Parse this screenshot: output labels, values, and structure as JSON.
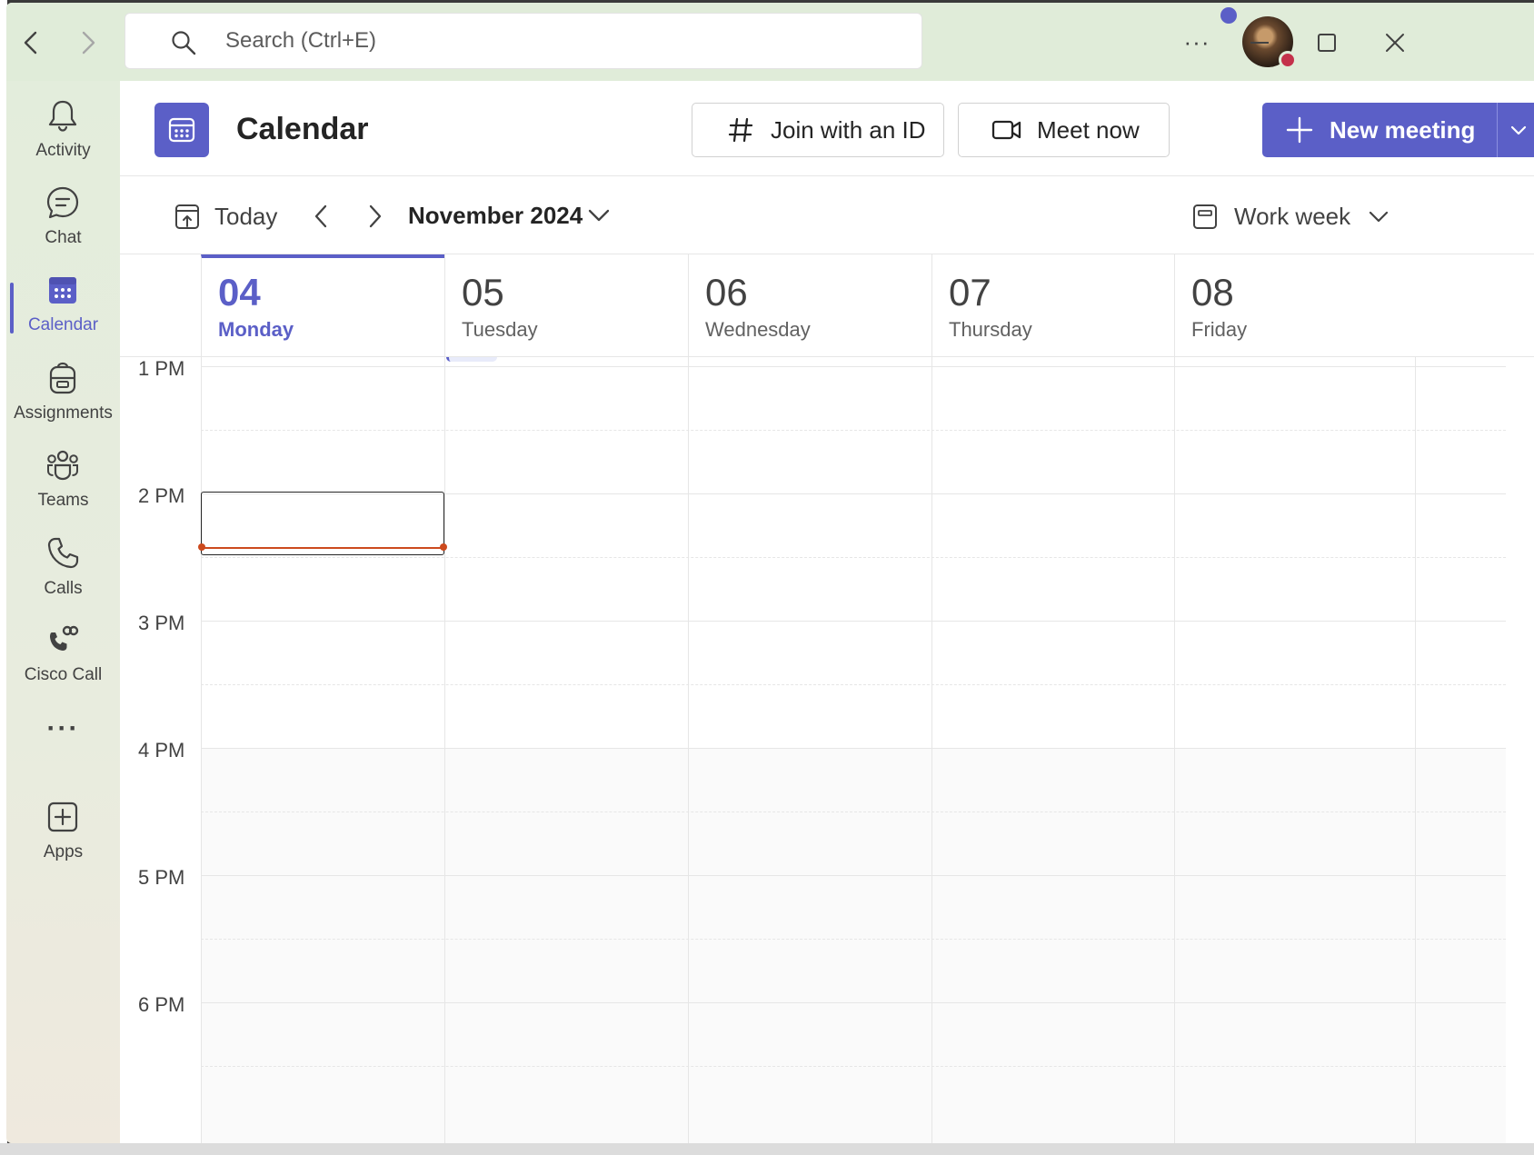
{
  "search": {
    "placeholder": "Search (Ctrl+E)"
  },
  "titlebar": {
    "more": "···"
  },
  "rail": {
    "items": [
      {
        "label": "Activity"
      },
      {
        "label": "Chat"
      },
      {
        "label": "Calendar"
      },
      {
        "label": "Assignments"
      },
      {
        "label": "Teams"
      },
      {
        "label": "Calls"
      },
      {
        "label": "Cisco Call"
      },
      {
        "label": "Apps"
      }
    ],
    "more": "···"
  },
  "header": {
    "title": "Calendar",
    "join_label": "Join with an ID",
    "meet_label": "Meet now",
    "new_meeting_label": "New meeting"
  },
  "toolbar": {
    "today_label": "Today",
    "month_label": "November 2024",
    "view_label": "Work week"
  },
  "days": [
    {
      "num": "04",
      "name": "Monday",
      "today": true
    },
    {
      "num": "05",
      "name": "Tuesday"
    },
    {
      "num": "06",
      "name": "Wednesday"
    },
    {
      "num": "07",
      "name": "Thursday"
    },
    {
      "num": "08",
      "name": "Friday"
    }
  ],
  "times": [
    "1 PM",
    "2 PM",
    "3 PM",
    "4 PM",
    "5 PM",
    "6 PM"
  ],
  "colors": {
    "accent": "#5b5fc7",
    "now_line": "#cc4a1e",
    "titlebar": "#e0ecd9"
  }
}
